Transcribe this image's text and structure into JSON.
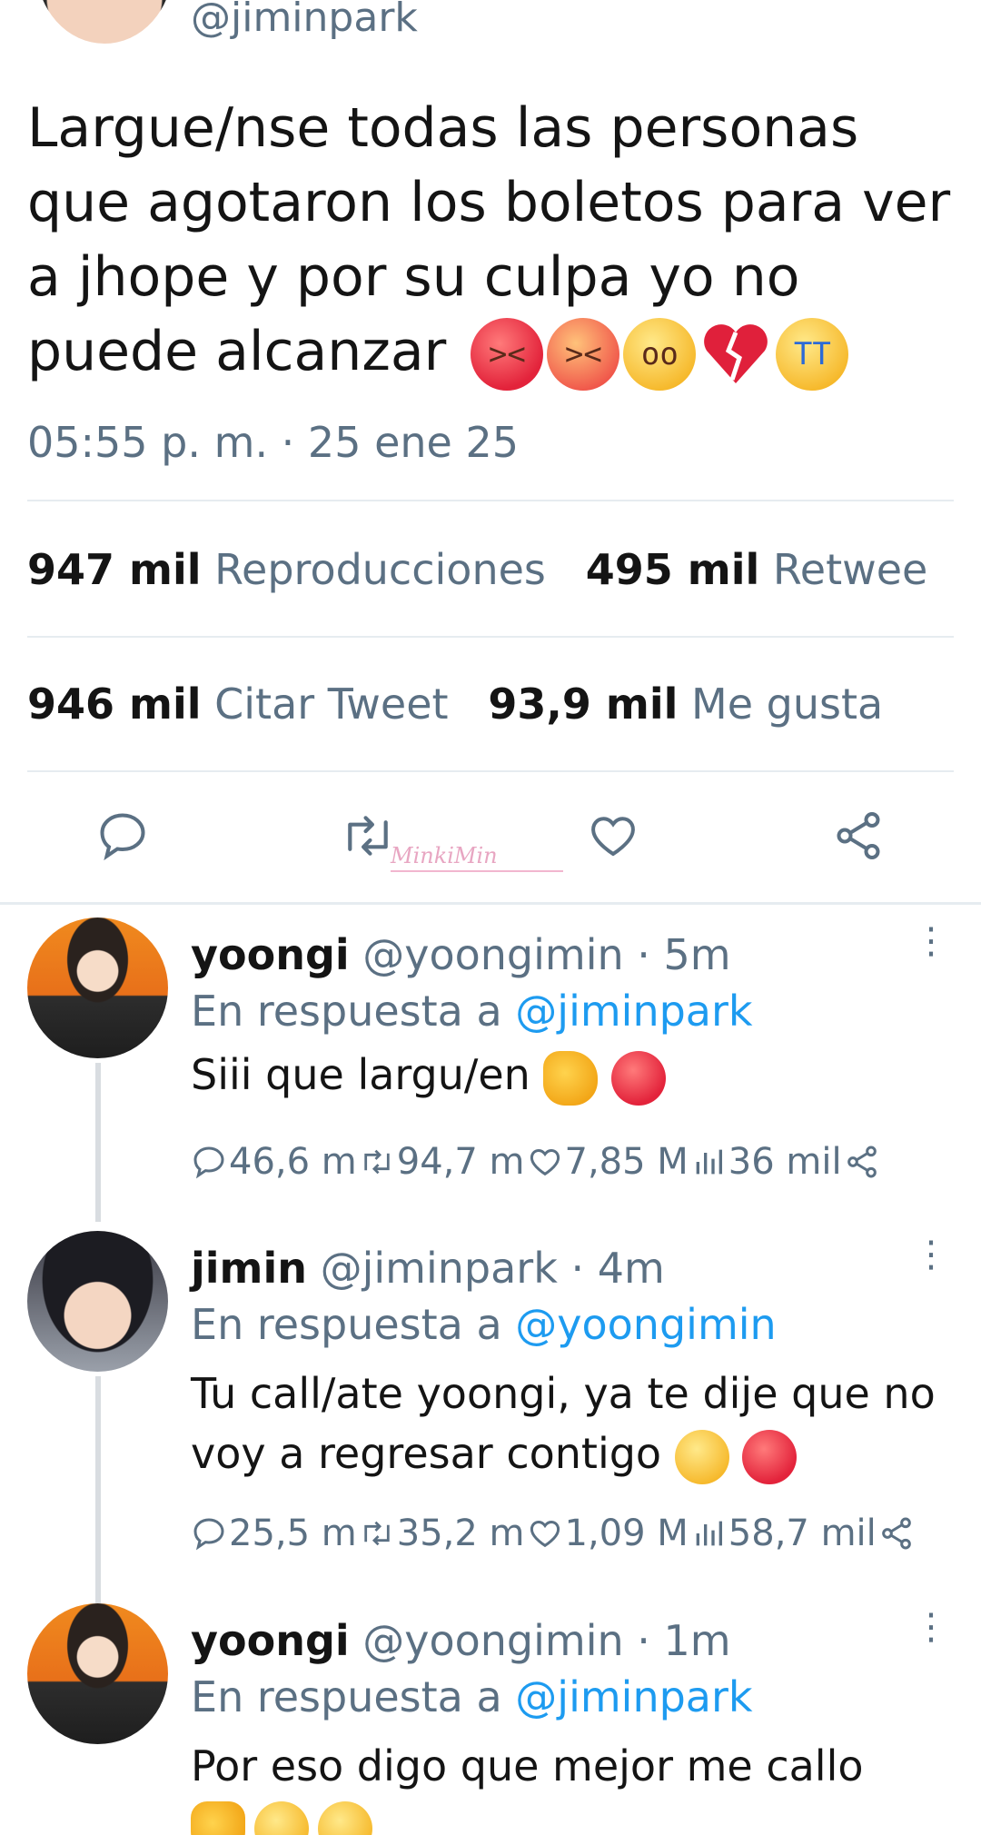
{
  "tweet": {
    "handle": "@jiminpark",
    "text": "Largue/nse todas las personas que agotaron los boletos para ver a jhope y por su culpa yo no puede alcanzar",
    "timestamp": "05:55 p. m. · 25 ene 25",
    "stats": {
      "views_value": "947 mil",
      "views_label": "Reproducciones",
      "retweets_value": "495 mil",
      "retweets_label": "Retwee",
      "quotes_value": "946 mil",
      "quotes_label": "Citar Tweet",
      "likes_value": "93,9 mil",
      "likes_label": "Me gusta"
    }
  },
  "watermark": "MinkiMin",
  "replies": [
    {
      "name": "yoongi",
      "handle": "@yoongimin · 5m",
      "in_reply_prefix": "En respuesta a",
      "in_reply_to": "@jiminpark",
      "text": "Siii que largu/en",
      "stats": {
        "replies": "46,6 m",
        "retweets": "94,7 m",
        "likes": "7,85 M",
        "views": "36 mil"
      }
    },
    {
      "name": "jimin",
      "handle": "@jiminpark · 4m",
      "in_reply_prefix": "En respuesta a",
      "in_reply_to": "@yoongimin",
      "text": "Tu call/ate  yoongi, ya te dije que no voy a regresar contigo",
      "stats": {
        "replies": "25,5 m",
        "retweets": "35,2 m",
        "likes": "1,09 M",
        "views": "58,7 mil"
      }
    },
    {
      "name": "yoongi",
      "handle": "@yoongimin · 1m",
      "in_reply_prefix": "En respuesta a",
      "in_reply_to": "@jiminpark",
      "text": "Por eso digo que mejor me callo"
    }
  ]
}
